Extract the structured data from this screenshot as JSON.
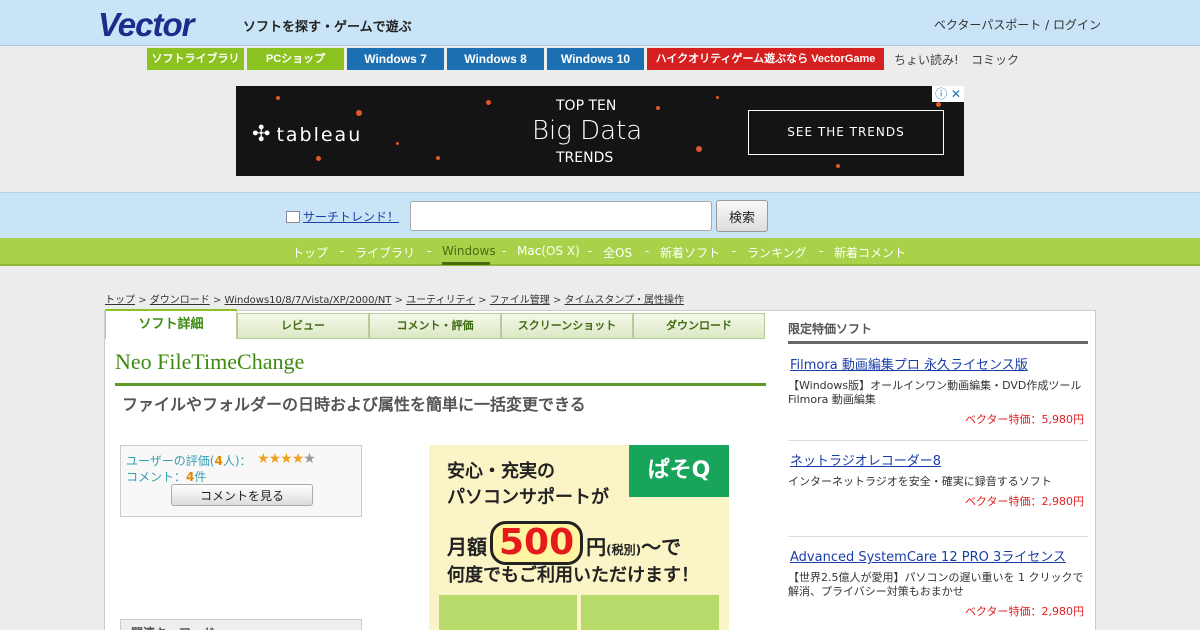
{
  "header": {
    "logo": "Vector",
    "tagline": "ソフトを探す・ゲームで遊ぶ",
    "passport": "ベクターパスポート",
    "login": "ログイン"
  },
  "nav": {
    "items": [
      {
        "label": "ソフトライブラリ",
        "color": "#8cc21f"
      },
      {
        "label": "PCショップ",
        "color": "#8cc21f"
      },
      {
        "label": "Windows 7",
        "color": "#1d6fb3"
      },
      {
        "label": "Windows 8",
        "color": "#1d6fb3"
      },
      {
        "label": "Windows 10",
        "color": "#1d6fb3"
      },
      {
        "label": "ハイクオリティゲーム遊ぶなら VectorGame",
        "color": "#d61f1f"
      }
    ],
    "text_links": [
      "ちょい読み!",
      "コミック"
    ]
  },
  "banner": {
    "brand": "tableau",
    "top": "TOP TEN",
    "big": "Big Data",
    "trends": "TRENDS",
    "cta": "SEE THE TRENDS",
    "close": "ⓘ ✕"
  },
  "search": {
    "trend_label": "サーチトレンド！",
    "placeholder": "",
    "button": "検索"
  },
  "categories": {
    "items": [
      "トップ",
      "ライブラリ",
      "Windows",
      "Mac(OS X)",
      "全OS",
      "新着ソフト",
      "ランキング",
      "新着コメント"
    ],
    "separator": "-",
    "active": "Windows"
  },
  "breadcrumb": {
    "items": [
      "トップ",
      "ダウンロード",
      "Windows10/8/7/Vista/XP/2000/NT",
      "ユーティリティ",
      "ファイル管理",
      "タイムスタンプ・属性操作"
    ],
    "separator": ">"
  },
  "tabs": [
    "ソフト詳細",
    "レビュー",
    "コメント・評価",
    "スクリーンショット",
    "ダウンロード"
  ],
  "software": {
    "title": "Neo FileTimeChange",
    "subtitle": "ファイルやフォルダーの日時および属性を簡単に一括変更できる"
  },
  "rating": {
    "label_prefix": "ユーザーの評価(",
    "users": "4",
    "label_suffix": "人)：",
    "stars": 4,
    "max_stars": 5,
    "comment_prefix": "コメント：",
    "comments": "4",
    "comment_suffix": "件",
    "button": "コメントを見る"
  },
  "related": {
    "title": "関連キーワード"
  },
  "ad": {
    "line1": "安心・充実の",
    "line2": "パソコンサポートが",
    "badge": "ぱそQ",
    "prefix": "月額",
    "price": "500",
    "yen": "円",
    "tax": "(税別)",
    "suffix": "〜で",
    "line4": "何度でもご利用いただけます！"
  },
  "sidebar": {
    "title": "限定特価ソフト",
    "items": [
      {
        "name": "Filmora 動画編集プロ 永久ライセンス版",
        "desc": "【Windows版】オールインワン動画編集・DVD作成ツール Filmora 動画編集",
        "price": "ベクター特価：5,980円"
      },
      {
        "name": "ネットラジオレコーダー8",
        "desc": "インターネットラジオを安全・確実に録音するソフト",
        "price": "ベクター特価：2,980円"
      },
      {
        "name": "Advanced SystemCare 12 PRO 3ライセンス",
        "desc": "【世界2.5億人が愛用】パソコンの遅い重いを 1 クリックで解消、プライバシー対策もおまかせ",
        "price": "ベクター特価：2,980円"
      }
    ]
  }
}
